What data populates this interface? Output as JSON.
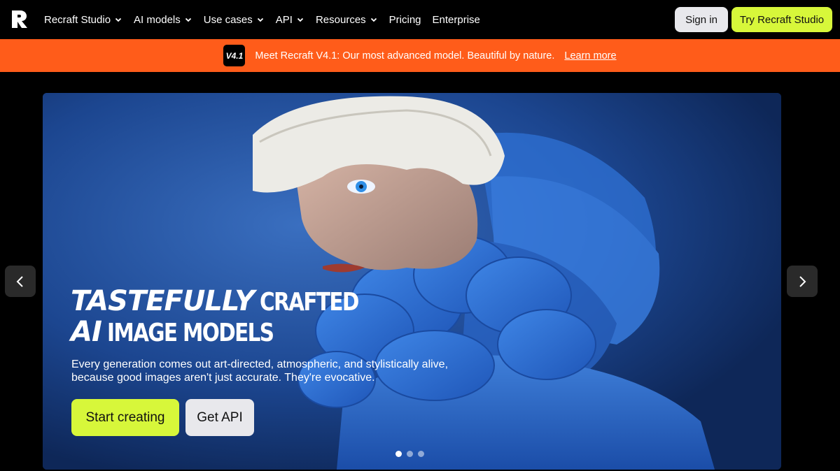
{
  "nav": {
    "items": [
      {
        "label": "Recraft Studio",
        "dropdown": true
      },
      {
        "label": "AI models",
        "dropdown": true
      },
      {
        "label": "Use cases",
        "dropdown": true
      },
      {
        "label": "API",
        "dropdown": true
      },
      {
        "label": "Resources",
        "dropdown": true
      },
      {
        "label": "Pricing",
        "dropdown": false
      },
      {
        "label": "Enterprise",
        "dropdown": false
      }
    ],
    "signin_label": "Sign in",
    "try_label": "Try Recraft Studio"
  },
  "banner": {
    "badge": "V4.1",
    "text": "Meet Recraft V4.1: Our most advanced model. Beautiful by nature.",
    "link": "Learn more"
  },
  "hero": {
    "title_line1_italic": "TASTEFULLY",
    "title_line1_cond": "CRAFTED",
    "title_line2_italic": "AI",
    "title_line2_cond": "IMAGE MODELS",
    "subtitle": "Every generation comes out art-directed, atmospheric, and stylistically alive, because good images aren't just accurate. They're evocative.",
    "primary_cta": "Start creating",
    "secondary_cta": "Get API",
    "slides": 3,
    "active_slide": 1
  },
  "colors": {
    "accent": "#d7f73a",
    "banner": "#ff5c1a",
    "hero_bg": "#1d4a93"
  }
}
